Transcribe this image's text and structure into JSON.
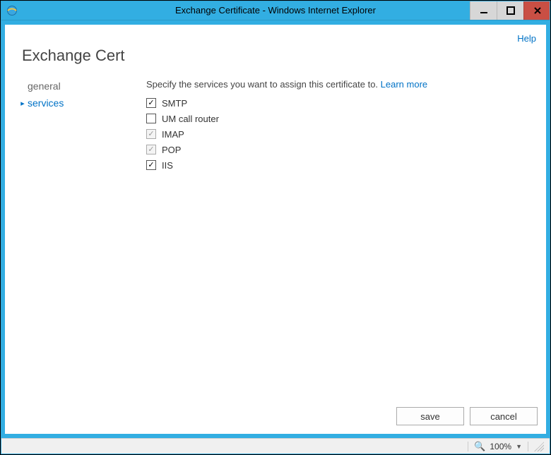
{
  "window": {
    "title": "Exchange Certificate - Windows Internet Explorer"
  },
  "header": {
    "help_label": "Help",
    "page_title": "Exchange Cert"
  },
  "sidebar": {
    "items": [
      {
        "label": "general",
        "active": false
      },
      {
        "label": "services",
        "active": true
      }
    ]
  },
  "content": {
    "instruction_prefix": "Specify the services you want to assign this certificate to. ",
    "learn_more_label": "Learn more",
    "services": [
      {
        "label": "SMTP",
        "checked": true,
        "disabled": false
      },
      {
        "label": "UM call router",
        "checked": false,
        "disabled": false
      },
      {
        "label": "IMAP",
        "checked": true,
        "disabled": true
      },
      {
        "label": "POP",
        "checked": true,
        "disabled": true
      },
      {
        "label": "IIS",
        "checked": true,
        "disabled": false
      }
    ]
  },
  "footer": {
    "save_label": "save",
    "cancel_label": "cancel"
  },
  "statusbar": {
    "zoom_text": "100%"
  }
}
